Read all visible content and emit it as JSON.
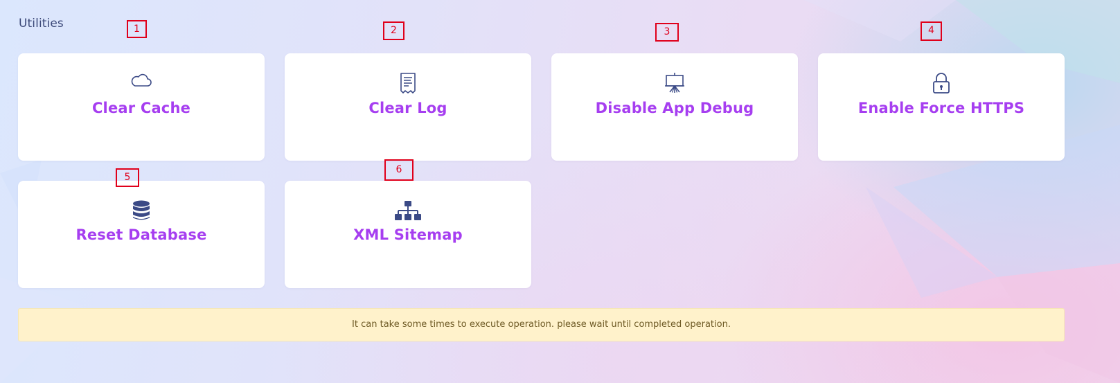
{
  "section": {
    "title": "Utilities"
  },
  "cards": [
    {
      "label": "Clear Cache",
      "icon": "cloud-icon"
    },
    {
      "label": "Clear Log",
      "icon": "receipt-icon"
    },
    {
      "label": "Disable App Debug",
      "icon": "presentation-board-icon"
    },
    {
      "label": "Enable Force HTTPS",
      "icon": "lock-icon"
    },
    {
      "label": "Reset Database",
      "icon": "database-icon"
    },
    {
      "label": "XML Sitemap",
      "icon": "sitemap-icon"
    }
  ],
  "markers": [
    "1",
    "2",
    "3",
    "4",
    "5",
    "6"
  ],
  "notice": {
    "text": "It can take some times to execute operation. please wait until completed operation."
  },
  "colors": {
    "label_accent": "#a63ef0",
    "icon": "#3b4a86",
    "title": "#3d4a7a",
    "notice_bg": "#fff2cb",
    "notice_text": "#6e5a25",
    "marker": "#e0001b"
  }
}
